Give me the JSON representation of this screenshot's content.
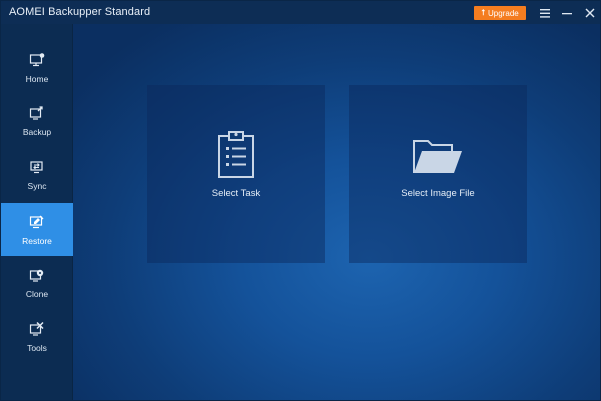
{
  "app": {
    "title": "AOMEI Backupper Standard",
    "upgrade_label": "Upgrade",
    "accent_color": "#f47d20"
  },
  "window_controls": {
    "menu_icon": "hamburger-icon",
    "minimize_icon": "minimize-icon",
    "close_icon": "close-icon"
  },
  "sidebar": {
    "active_color": "#2f8fe6",
    "items": [
      {
        "label": "Home",
        "icon": "home-icon"
      },
      {
        "label": "Backup",
        "icon": "backup-icon"
      },
      {
        "label": "Sync",
        "icon": "sync-icon"
      },
      {
        "label": "Restore",
        "icon": "restore-icon",
        "active": true
      },
      {
        "label": "Clone",
        "icon": "clone-icon"
      },
      {
        "label": "Tools",
        "icon": "tools-icon"
      }
    ]
  },
  "main": {
    "cards": [
      {
        "label": "Select Task",
        "icon": "clipboard-icon"
      },
      {
        "label": "Select Image File",
        "icon": "folder-icon"
      }
    ]
  }
}
